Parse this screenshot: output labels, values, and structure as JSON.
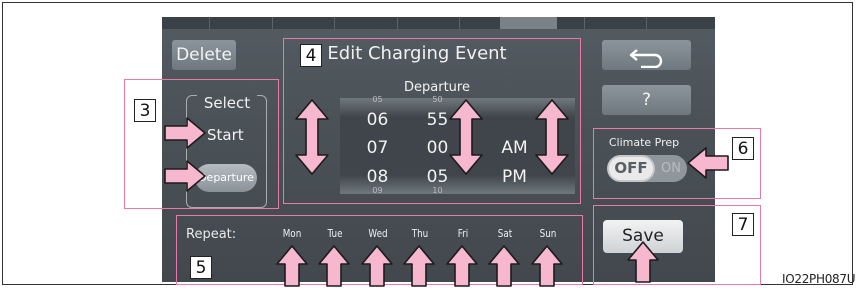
{
  "header": {
    "delete_label": "Delete",
    "title": "Edit Charging Event",
    "back_glyph": "⮌",
    "help_label": "?"
  },
  "select_group": {
    "label": "Select",
    "start_label": "Start",
    "departure_label": "Departure"
  },
  "time_picker": {
    "label": "Departure",
    "hours": [
      "06",
      "07",
      "08"
    ],
    "minutes": [
      "55",
      "00",
      "05"
    ],
    "meridiem": [
      "AM",
      "PM"
    ]
  },
  "climate": {
    "label": "Climate Prep",
    "off_label": "OFF",
    "on_label": "ON"
  },
  "repeat": {
    "label": "Repeat:",
    "days": [
      "Mon",
      "Tue",
      "Wed",
      "Thu",
      "Fri",
      "Sat",
      "Sun"
    ]
  },
  "save_label": "Save",
  "callouts": [
    "3",
    "4",
    "5",
    "6",
    "7"
  ],
  "doc_code": "IO22PH087U",
  "colors": {
    "callout_border": "#e77aa9",
    "arrow_fill": "#f6b7cf",
    "arrow_stroke": "#1c1c1c",
    "screen_bg": "#4a5157",
    "button_gray": "#7d868c"
  },
  "icons": {
    "back": "return-arrow-icon",
    "pointer": "callout-arrow-icon"
  }
}
